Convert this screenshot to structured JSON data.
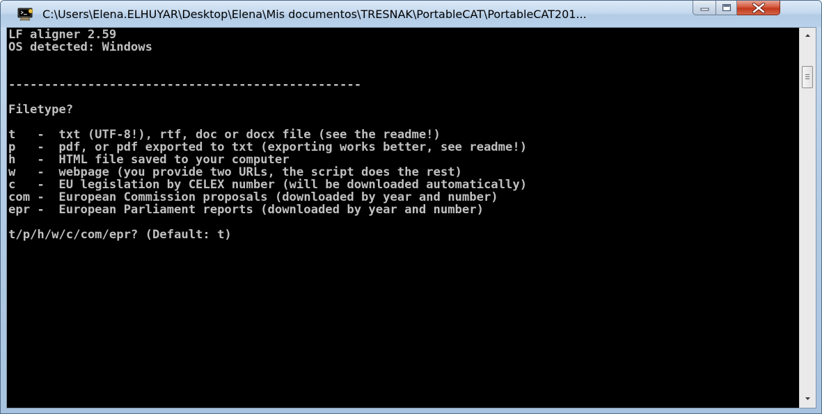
{
  "window": {
    "title": "C:\\Users\\Elena.ELHUYAR\\Desktop\\Elena\\Mis documentos\\TRESNAK\\PortableCAT\\PortableCAT201..."
  },
  "icons": {
    "app": "command-prompt-icon",
    "minimize": "minimize-icon",
    "maximize": "maximize-icon",
    "close": "close-icon",
    "scroll_up": "scroll-up-arrow-icon",
    "scroll_down": "scroll-down-arrow-icon"
  },
  "colors": {
    "console_background": "#000000",
    "console_text": "#c0c0c0",
    "close_button": "#c9442b",
    "titlebar": "#c5d9ee"
  },
  "console": {
    "lines": [
      "LF aligner 2.59",
      "OS detected: Windows",
      "",
      "",
      "-------------------------------------------------",
      "",
      "Filetype?",
      "",
      "t   -  txt (UTF-8!), rtf, doc or docx file (see the readme!)",
      "p   -  pdf, or pdf exported to txt (exporting works better, see readme!)",
      "h   -  HTML file saved to your computer",
      "w   -  webpage (you provide two URLs, the script does the rest)",
      "c   -  EU legislation by CELEX number (will be downloaded automatically)",
      "com -  European Commission proposals (downloaded by year and number)",
      "epr -  European Parliament reports (downloaded by year and number)",
      "",
      "t/p/h/w/c/com/epr? (Default: t)"
    ]
  }
}
